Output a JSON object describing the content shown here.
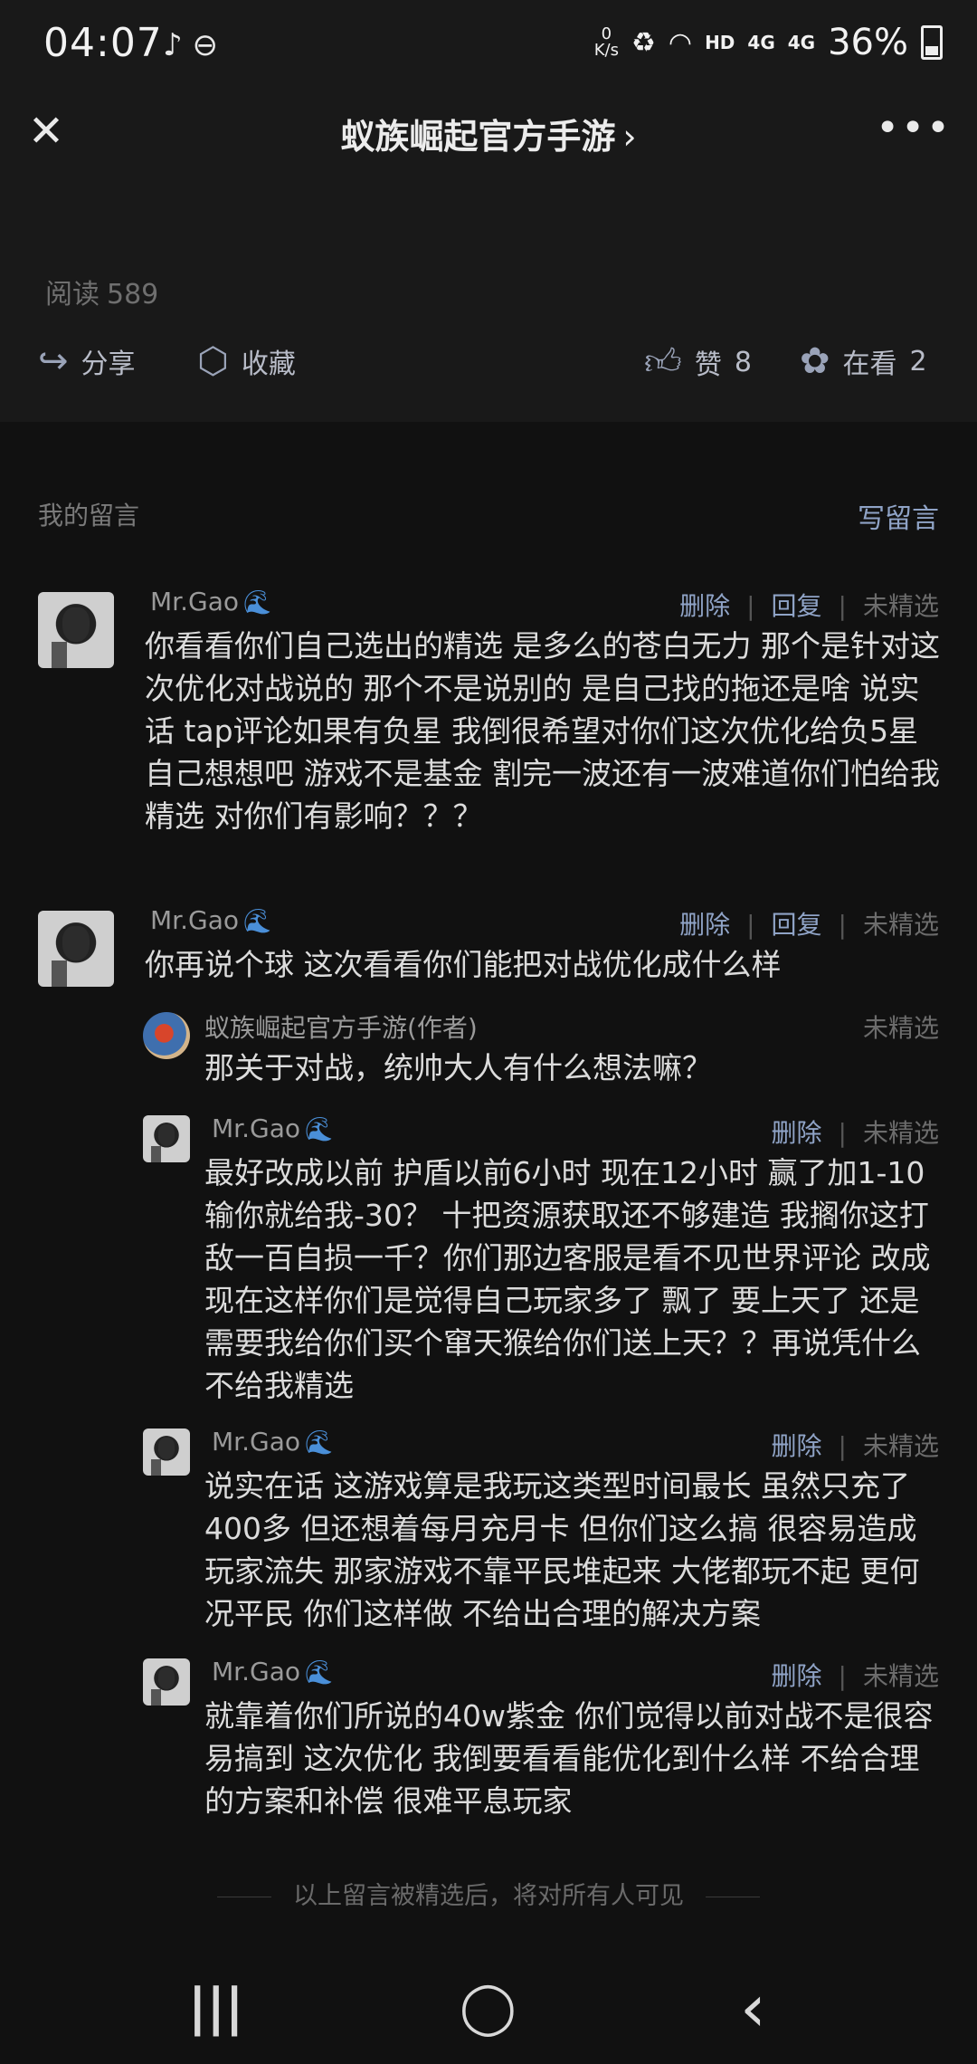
{
  "status_bar": {
    "time": "04:07",
    "left_icons": "♪ ⊖",
    "net_speed_value": "0",
    "net_speed_unit": "K/s",
    "hd": "HD",
    "signal1": "4G",
    "signal2": "4G",
    "battery": "36%"
  },
  "header": {
    "title": "蚁族崛起官方手游",
    "chevron": "›",
    "close": "✕",
    "more": "•••"
  },
  "article": {
    "read_label": "阅读",
    "read_count": "589",
    "share_label": "分享",
    "favorite_label": "收藏",
    "like_label": "赞",
    "like_count": "8",
    "watching_label": "在看",
    "watching_count": "2"
  },
  "comments_section": {
    "title": "我的留言",
    "write_label": "写留言"
  },
  "comments": [
    {
      "name": "Mr.Gao",
      "delete": "删除",
      "reply": "回复",
      "status": "未精选",
      "text": "你看看你们自己选出的精选 是多么的苍白无力 那个是针对这次优化对战说的 那个不是说别的 是自己找的拖还是啥 说实话 tap评论如果有负星 我倒很希望对你们这次优化给负5星 自己想想吧 游戏不是基金 割完一波还有一波难道你们怕给我精选 对你们有影响？？？"
    },
    {
      "name": "Mr.Gao",
      "delete": "删除",
      "reply": "回复",
      "status": "未精选",
      "text": "你再说个球 这次看看你们能把对战优化成什么样"
    }
  ],
  "replies": [
    {
      "name": "蚁族崛起官方手游(作者)",
      "status": "未精选",
      "text": "那关于对战，统帅大人有什么想法嘛？"
    },
    {
      "name": "Mr.Gao",
      "delete": "删除",
      "status": "未精选",
      "text": "最好改成以前 护盾以前6小时 现在12小时 赢了加1-10 输你就给我-30？ 十把资源获取还不够建造 我搁你这打敌一百自损一千？你们那边客服是看不见世界评论 改成现在这样你们是觉得自己玩家多了 飘了 要上天了 还是需要我给你们买个窜天猴给你们送上天？？再说凭什么 不给我精选"
    },
    {
      "name": "Mr.Gao",
      "delete": "删除",
      "status": "未精选",
      "text": "说实在话 这游戏算是我玩这类型时间最长 虽然只充了400多 但还想着每月充月卡 但你们这么搞 很容易造成玩家流失 那家游戏不靠平民堆起来 大佬都玩不起 更何况平民  你们这样做 不给出合理的解决方案"
    },
    {
      "name": "Mr.Gao",
      "delete": "删除",
      "status": "未精选",
      "text": "就靠着你们所说的40w紫金 你们觉得以前对战不是很容易搞到  这次优化 我倒要看看能优化到什么样 不给合理的方案和补偿 很难平息玩家"
    }
  ],
  "footer_note": "以上留言被精选后，将对所有人可见",
  "nav": {
    "recents": "|||",
    "home": "◯",
    "back": "‹"
  }
}
